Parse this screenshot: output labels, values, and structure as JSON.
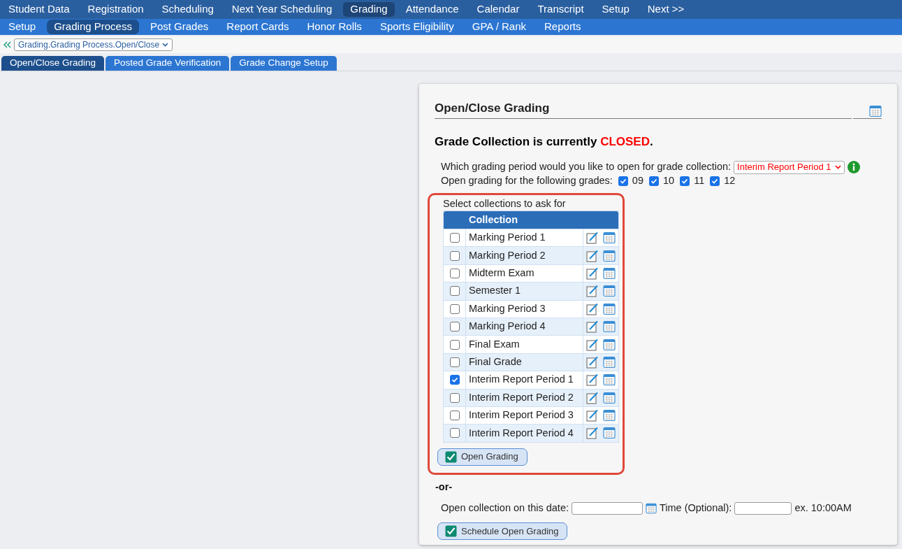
{
  "top_menu": [
    {
      "label": "Student Data",
      "selected": false
    },
    {
      "label": "Registration",
      "selected": false
    },
    {
      "label": "Scheduling",
      "selected": false
    },
    {
      "label": "Next Year Scheduling",
      "selected": false
    },
    {
      "label": "Grading",
      "selected": true
    },
    {
      "label": "Attendance",
      "selected": false
    },
    {
      "label": "Calendar",
      "selected": false
    },
    {
      "label": "Transcript",
      "selected": false
    },
    {
      "label": "Setup",
      "selected": false
    },
    {
      "label": "Next >>",
      "selected": false
    }
  ],
  "sub_menu": [
    {
      "label": "Setup",
      "selected": false
    },
    {
      "label": "Grading Process",
      "selected": true
    },
    {
      "label": "Post Grades",
      "selected": false
    },
    {
      "label": "Report Cards",
      "selected": false
    },
    {
      "label": "Honor Rolls",
      "selected": false
    },
    {
      "label": "Sports Eligibility",
      "selected": false
    },
    {
      "label": "GPA / Rank",
      "selected": false
    },
    {
      "label": "Reports",
      "selected": false
    }
  ],
  "breadcrumb": {
    "value": "Grading.Grading Process.Open/Close"
  },
  "tabs": [
    {
      "label": "Open/Close Grading",
      "selected": true
    },
    {
      "label": "Posted Grade Verification",
      "selected": false
    },
    {
      "label": "Grade Change Setup",
      "selected": false
    }
  ],
  "panel": {
    "title": "Open/Close Grading",
    "status": {
      "prefix": "Grade Collection is currently ",
      "value": "CLOSED",
      "suffix": ".",
      "kind": "closed"
    },
    "period_label": "Which grading period would you like to open for grade collection:",
    "period_value": "Interim Report Period 1",
    "grades_label": "Open grading for the following grades:",
    "grades": [
      {
        "label": "09",
        "checked": true
      },
      {
        "label": "10",
        "checked": true
      },
      {
        "label": "11",
        "checked": true
      },
      {
        "label": "12",
        "checked": true
      }
    ],
    "collections": {
      "highlighted": true,
      "label": "Select collections to ask for",
      "column": "Collection",
      "rows": [
        {
          "name": "Marking Period 1",
          "checked": false
        },
        {
          "name": "Marking Period 2",
          "checked": false
        },
        {
          "name": "Midterm Exam",
          "checked": false
        },
        {
          "name": "Semester 1",
          "checked": false
        },
        {
          "name": "Marking Period 3",
          "checked": false
        },
        {
          "name": "Marking Period 4",
          "checked": false
        },
        {
          "name": "Final Exam",
          "checked": false
        },
        {
          "name": "Final Grade",
          "checked": false
        },
        {
          "name": "Interim Report Period 1",
          "checked": true
        },
        {
          "name": "Interim Report Period 2",
          "checked": false
        },
        {
          "name": "Interim Report Period 3",
          "checked": false
        },
        {
          "name": "Interim Report Period 4",
          "checked": false
        }
      ],
      "button": "Open Grading"
    },
    "or_text": "-or-",
    "date_label": "Open collection on this date:",
    "time_label": "Time (Optional):",
    "time_example": "ex. 10:00AM",
    "schedule_button": "Schedule Open Grading"
  }
}
